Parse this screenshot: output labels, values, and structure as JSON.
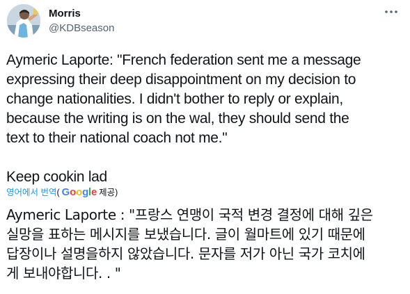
{
  "author": {
    "name": "Morris",
    "handle": "@KDBseason"
  },
  "icons": {
    "more": "more-horizontal-icon",
    "avatar": "profile-photo"
  },
  "tweet": {
    "text_lines": [
      "Aymeric Laporte: \"French federation sent me a message",
      "expressing their deep disappointment on my decision to",
      "change nationalities. I didn't bother to reply or explain,",
      "because the writing is on the wal, they should send the",
      "text to their national coach not me.\""
    ],
    "comment": "Keep cookin lad"
  },
  "translation": {
    "link_label": "영어에서 번역",
    "open_paren": "(",
    "google_letters": [
      "G",
      "o",
      "o",
      "g",
      "l",
      "e"
    ],
    "provider_suffix": " 제공)",
    "text_lines": [
      "Aymeric Laporte : \"프랑스 연맹이 국적 변경 결정에 대해 깊은",
      "실망을 표하는 메시지를 보냈습니다. 글이 월마트에 있기 때문에",
      "답장이나 설명을하지 않았습니다. 문자를 저가 아닌 국가 코치에",
      "게 보내야합니다. . \""
    ]
  },
  "colors": {
    "link": "#1d9bf0",
    "text": "#0f1419",
    "secondary": "#536471"
  }
}
